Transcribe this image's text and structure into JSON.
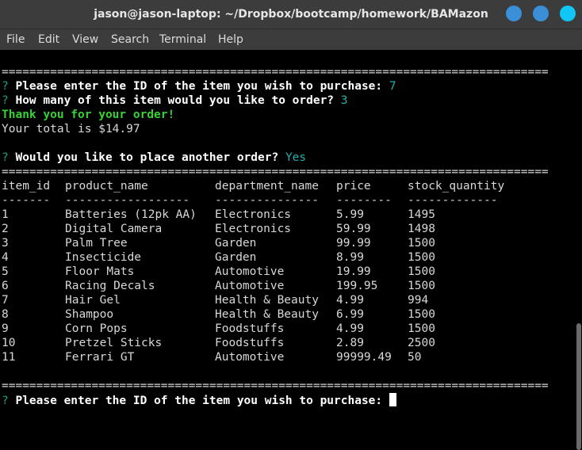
{
  "window": {
    "title": "jason@jason-laptop: ~/Dropbox/bootcamp/homework/BAMazon"
  },
  "menu": [
    "File",
    "Edit",
    "View",
    "Search",
    "Terminal",
    "Help"
  ],
  "colors": {
    "prompt": "#16a085",
    "answer": "#1fb0b0",
    "success": "#35d335",
    "background": "#000000"
  },
  "terminal": {
    "rule": "===============================================================================",
    "prompt_marker": "?",
    "q1": {
      "question": "Please enter the ID of the item you wish to purchase:",
      "answer": "7"
    },
    "q2": {
      "question": "How many of this item would you like to order?",
      "answer": "3"
    },
    "thanks": "Thank you for your order!",
    "total": "Your total is $14.97",
    "q3": {
      "question": "Would you like to place another order?",
      "answer": "Yes"
    },
    "table": {
      "headers": [
        "item_id",
        "product_name",
        "department_name",
        "price",
        "stock_quantity"
      ],
      "underlines": [
        "-------",
        "------------------",
        "---------------",
        "--------",
        "-------------"
      ],
      "rows": [
        [
          "1",
          "Batteries (12pk AA)",
          "Electronics",
          "5.99",
          "1495"
        ],
        [
          "2",
          "Digital Camera",
          "Electronics",
          "59.99",
          "1498"
        ],
        [
          "3",
          "Palm Tree",
          "Garden",
          "99.99",
          "1500"
        ],
        [
          "4",
          "Insecticide",
          "Garden",
          "8.99",
          "1500"
        ],
        [
          "5",
          "Floor Mats",
          "Automotive",
          "19.99",
          "1500"
        ],
        [
          "6",
          "Racing Decals",
          "Automotive",
          "199.95",
          "1500"
        ],
        [
          "7",
          "Hair Gel",
          "Health & Beauty",
          "4.99",
          "994"
        ],
        [
          "8",
          "Shampoo",
          "Health & Beauty",
          "6.99",
          "1500"
        ],
        [
          "9",
          "Corn Pops",
          "Foodstuffs",
          "4.99",
          "1500"
        ],
        [
          "10",
          "Pretzel Sticks",
          "Foodstuffs",
          "2.89",
          "2500"
        ],
        [
          "11",
          "Ferrari GT",
          "Automotive",
          "99999.49",
          "50"
        ]
      ]
    },
    "q4": {
      "question": "Please enter the ID of the item you wish to purchase:"
    }
  }
}
